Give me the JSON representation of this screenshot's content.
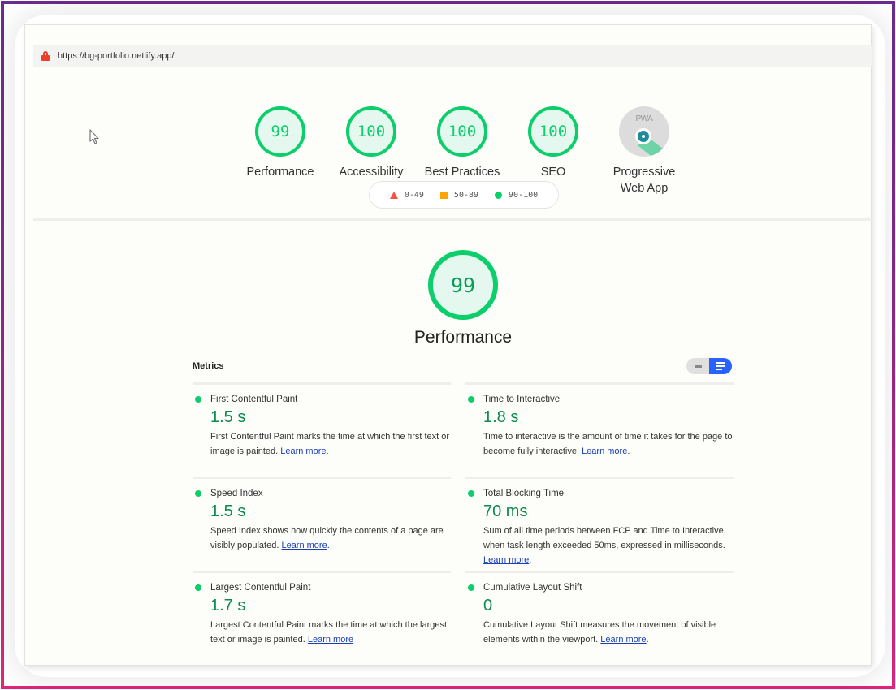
{
  "browser": {
    "url": "https://bg-portfolio.netlify.app/"
  },
  "summary": {
    "gauges": [
      {
        "score": "99",
        "label": "Performance"
      },
      {
        "score": "100",
        "label": "Accessibility"
      },
      {
        "score": "100",
        "label": "Best Practices"
      },
      {
        "score": "100",
        "label": "SEO"
      }
    ],
    "pwa": {
      "badge_text": "PWA",
      "label_line1": "Progressive",
      "label_line2": "Web App"
    }
  },
  "legend": {
    "items": [
      {
        "shape": "triangle",
        "range": "0-49",
        "color": "#ff4e42"
      },
      {
        "shape": "square",
        "range": "50-89",
        "color": "#ffa400"
      },
      {
        "shape": "circle",
        "range": "90-100",
        "color": "#0cce6b"
      }
    ]
  },
  "performance": {
    "score": "99",
    "title": "Performance"
  },
  "metrics": {
    "title": "Metrics",
    "learn_more": "Learn more",
    "items": [
      {
        "name": "First Contentful Paint",
        "value": "1.5 s",
        "desc": "First Contentful Paint marks the time at which the first text or image is painted.",
        "trail": "."
      },
      {
        "name": "Time to Interactive",
        "value": "1.8 s",
        "desc": "Time to interactive is the amount of time it takes for the page to become fully interactive.",
        "trail": "."
      },
      {
        "name": "Speed Index",
        "value": "1.5 s",
        "desc": "Speed Index shows how quickly the contents of a page are visibly populated.",
        "trail": "."
      },
      {
        "name": "Total Blocking Time",
        "value": "70 ms",
        "desc": "Sum of all time periods between FCP and Time to Interactive, when task length exceeded 50ms, expressed in milliseconds.",
        "trail": "."
      },
      {
        "name": "Largest Contentful Paint",
        "value": "1.7 s",
        "desc": "Largest Contentful Paint marks the time at which the largest text or image is painted.",
        "trail": ""
      },
      {
        "name": "Cumulative Layout Shift",
        "value": "0",
        "desc": "Cumulative Layout Shift measures the movement of visible elements within the viewport.",
        "trail": "."
      }
    ]
  },
  "colors": {
    "pass": "#0cce6b",
    "toggle_active": "#2962ff"
  }
}
